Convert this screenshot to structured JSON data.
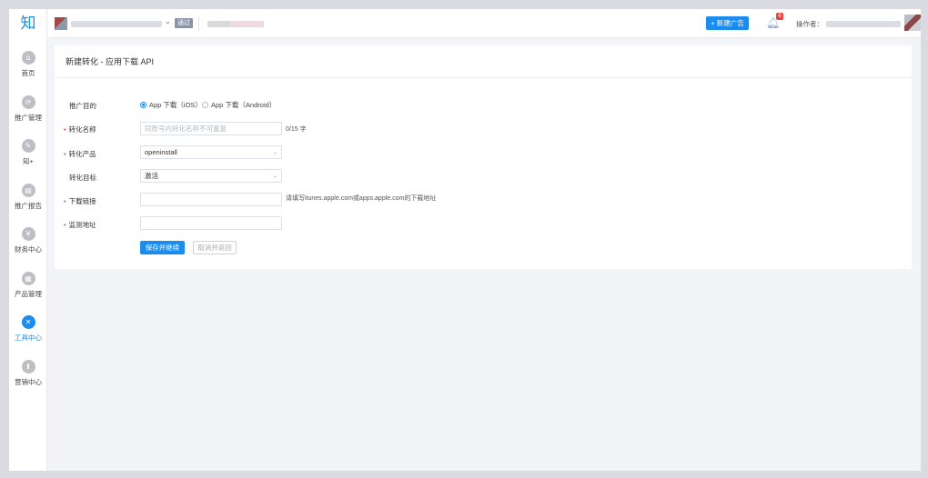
{
  "sidebar": {
    "logo": "知",
    "items": [
      {
        "label": "首页",
        "icon": "home-icon",
        "glyph": "⌂",
        "active": false
      },
      {
        "label": "推广管理",
        "icon": "promotion-icon",
        "glyph": "⟳",
        "active": false
      },
      {
        "label": "知+",
        "icon": "zhiplus-icon",
        "glyph": "✎",
        "active": false
      },
      {
        "label": "推广报告",
        "icon": "report-icon",
        "glyph": "▤",
        "active": false
      },
      {
        "label": "财务中心",
        "icon": "finance-icon",
        "glyph": "¥",
        "active": false
      },
      {
        "label": "产品管理",
        "icon": "product-icon",
        "glyph": "▦",
        "active": false
      },
      {
        "label": "工具中心",
        "icon": "tools-icon",
        "glyph": "✕",
        "active": true
      },
      {
        "label": "营销中心",
        "icon": "marketing-icon",
        "glyph": "⬆",
        "active": false
      }
    ]
  },
  "header": {
    "account_status": "通过",
    "new_ad_label": "+ 新建广告",
    "notification_count": "6",
    "operator_label": "操作者："
  },
  "form": {
    "title": "新建转化 - 应用下载 API",
    "purpose": {
      "label": "推广目的",
      "options": [
        "App 下载（iOS）",
        "App 下载（Android）"
      ],
      "selected": "App 下载（iOS）"
    },
    "conversion_name": {
      "label": "转化名称",
      "placeholder": "同账号内转化名称不可重复",
      "counter": "0/15 字"
    },
    "conversion_product": {
      "label": "转化产品",
      "value": "openinstall"
    },
    "conversion_target": {
      "label": "转化目标",
      "value": "激活"
    },
    "download_link": {
      "label": "下载链接",
      "hint": "请填写itunes.apple.com或apps.apple.com的下载地址"
    },
    "monitor_url": {
      "label": "监测地址"
    },
    "save_label": "保存并继续",
    "cancel_label": "取消并返回"
  },
  "colors": {
    "accent": "#1a8cf0",
    "required": "#e8423d"
  }
}
